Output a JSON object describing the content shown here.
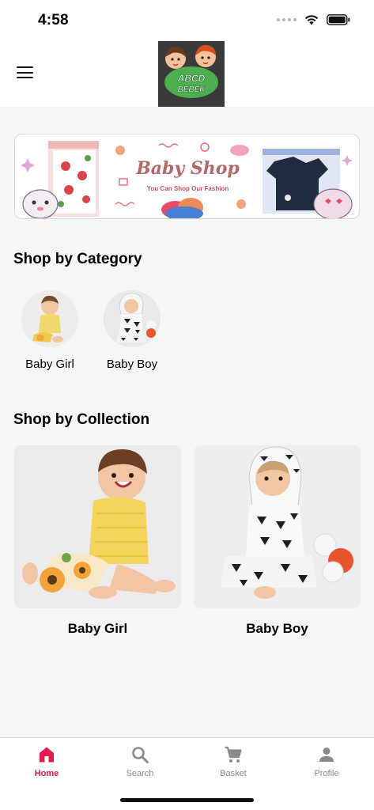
{
  "status_bar": {
    "time": "4:58"
  },
  "header": {
    "menu_icon": "hamburger-menu-icon",
    "logo_text_top": "ABCD",
    "logo_text_bottom": "BEBEK"
  },
  "banner": {
    "title": "Baby Shop",
    "subtitle": "You Can Shop Our Fashion"
  },
  "category_section": {
    "title": "Shop by Category",
    "items": [
      {
        "label": "Baby Girl"
      },
      {
        "label": "Baby Boy"
      }
    ]
  },
  "collection_section": {
    "title": "Shop by Collection",
    "items": [
      {
        "label": "Baby Girl"
      },
      {
        "label": "Baby Boy"
      }
    ]
  },
  "tab_bar": {
    "active_color": "#e8194e",
    "inactive_color": "#8a8a8a",
    "tabs": [
      {
        "label": "Home",
        "icon": "home-icon",
        "active": true
      },
      {
        "label": "Search",
        "icon": "search-icon",
        "active": false
      },
      {
        "label": "Basket",
        "icon": "cart-icon",
        "active": false
      },
      {
        "label": "Profile",
        "icon": "person-icon",
        "active": false
      }
    ]
  }
}
